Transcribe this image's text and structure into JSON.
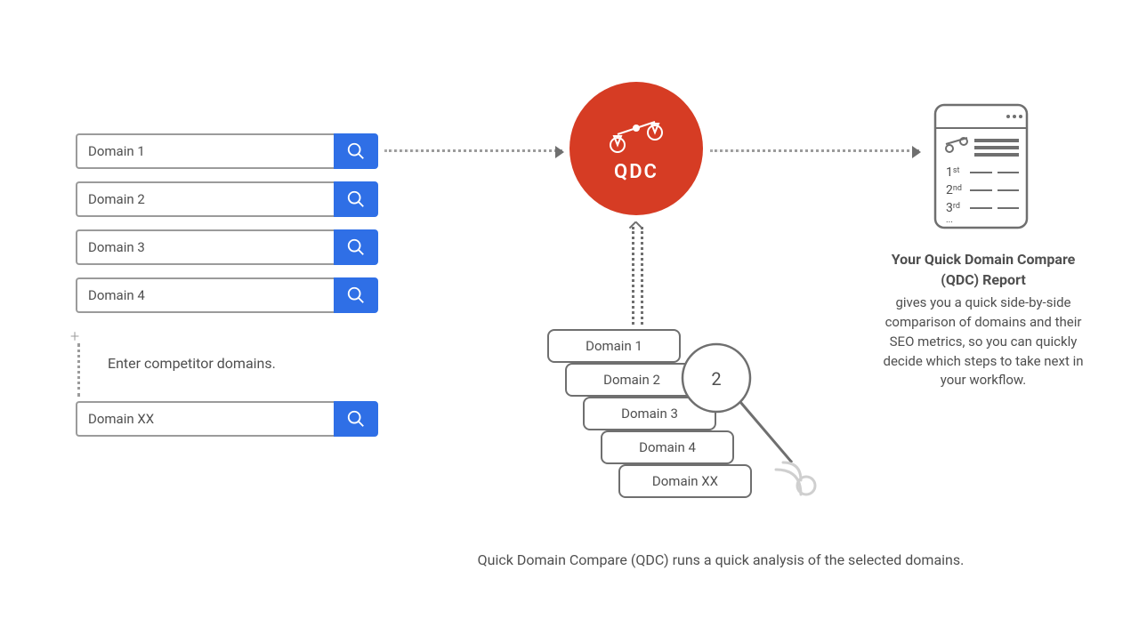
{
  "inputs": {
    "items": [
      {
        "placeholder": "Domain 1"
      },
      {
        "placeholder": "Domain 2"
      },
      {
        "placeholder": "Domain 3"
      },
      {
        "placeholder": "Domain 4"
      }
    ],
    "more_placeholder": "Domain XX",
    "instruction": "Enter competitor domains."
  },
  "qdc": {
    "label": "QDC"
  },
  "stack": {
    "items": [
      "Domain 1",
      "Domain 2",
      "Domain 3",
      "Domain 4",
      "Domain XX"
    ]
  },
  "caption": "Quick Domain Compare (QDC) runs a quick analysis of the selected domains.",
  "report_panel": {
    "rank1": "1",
    "rank1_suffix": "st",
    "rank2": "2",
    "rank2_suffix": "nd",
    "rank3": "3",
    "rank3_suffix": "rd",
    "ellipsis": "..."
  },
  "right": {
    "heading": "Your Quick Domain Compare (QDC) Report",
    "body": "gives you a quick side-by-side comparison of domains and their SEO metrics, so you can quickly decide which steps to take next in your workflow."
  }
}
